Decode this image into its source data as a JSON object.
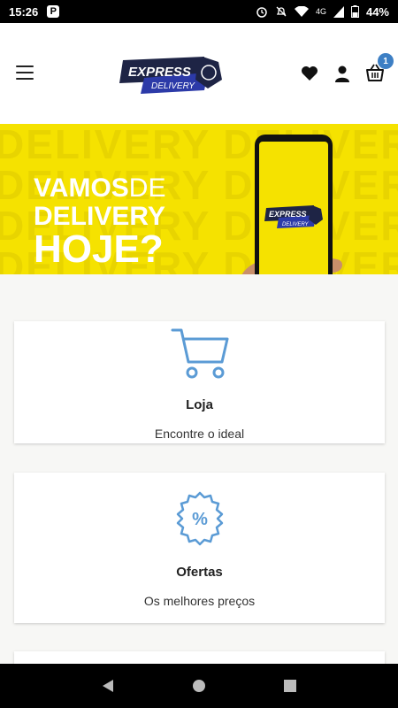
{
  "status_bar": {
    "time": "15:26",
    "app_badge": "P",
    "network": "4G",
    "battery": "44%"
  },
  "header": {
    "logo_top": "EXPRESS",
    "logo_bottom": "DELIVERY",
    "cart_count": "1"
  },
  "banner": {
    "bg_word": "DELIVERY DELIVERY",
    "line1_bold": "VAMOS",
    "line1_thin": "DE",
    "line2": "DELIVERY",
    "line3": "HOJE?",
    "phone_logo_top": "EXPRESS",
    "phone_logo_bottom": "DELIVERY"
  },
  "cards": [
    {
      "title": "Loja",
      "subtitle": "Encontre o ideal",
      "icon": "cart-icon"
    },
    {
      "title": "Ofertas",
      "subtitle": "Os melhores preços",
      "icon": "percent-badge-icon"
    }
  ],
  "colors": {
    "brand_yellow": "#f5e200",
    "accent_blue": "#5b9bd5",
    "badge_blue": "#3d7fc4"
  }
}
